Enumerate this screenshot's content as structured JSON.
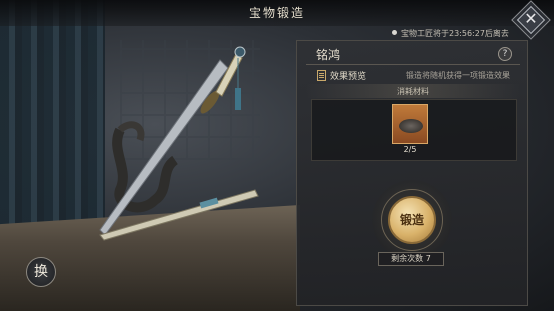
{
  "header": {
    "title": "宝物锻造"
  },
  "timer": {
    "text": "宝物工匠将于23:56:27后离去"
  },
  "panel": {
    "item_name": "铭鸿",
    "help_label": "?",
    "preview_label": "效果预览",
    "preview_desc": "锻造将随机获得一项锻造效果",
    "materials_title": "消耗材料",
    "material_count": "2/5",
    "forge_label": "锻造",
    "remaining_label": "剩余次数 7"
  },
  "controls": {
    "swap_label": "换",
    "close_label": "✕"
  },
  "icons": {
    "close": "close-icon",
    "help": "question-icon",
    "preview": "document-icon",
    "material": "ore-icon",
    "weapon": "sword-icon"
  },
  "colors": {
    "accent_gold": "#d9b26a",
    "material_slot": "#c07a3a"
  }
}
